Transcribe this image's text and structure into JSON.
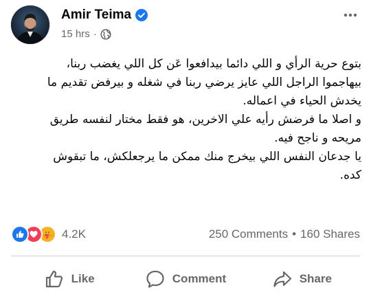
{
  "post": {
    "author": "Amir Teima",
    "verified_icon": "verified-badge-icon",
    "timestamp": "15 hrs",
    "separator": "·",
    "audience_icon": "globe-icon",
    "more_icon": "more-options-icon",
    "lines": [
      "بتوع حرية الرأي و اللي دائما بيدافعوا عَن كل اللي يغضب ربنا،",
      "بيهاجموا الراجل اللي عايز يرضي ربنا في شغله و بيرفض تقديم ما",
      "يخدش الحياء في اعماله.",
      "و اصلا ما فرضش رأيه علي الاخرين، هو فقط مختار لنفسه طريق",
      "مريحه و ناجح فيه.",
      "يا جدعان النفس اللي بيخرج منك ممكن ما يرجعلكش، ما تبقوش",
      "كده."
    ]
  },
  "reactions": {
    "icons": [
      "like-reaction-icon",
      "love-reaction-icon",
      "care-reaction-icon"
    ],
    "count": "4.2K",
    "comments": "250 Comments",
    "dot": "•",
    "shares": "160 Shares"
  },
  "actions": {
    "like": "Like",
    "comment": "Comment",
    "share": "Share"
  },
  "colors": {
    "verified": "#1877f2",
    "like": "#1877f2",
    "love": "#f33e58",
    "care": "#f7b125",
    "secondary_text": "#65676b"
  }
}
